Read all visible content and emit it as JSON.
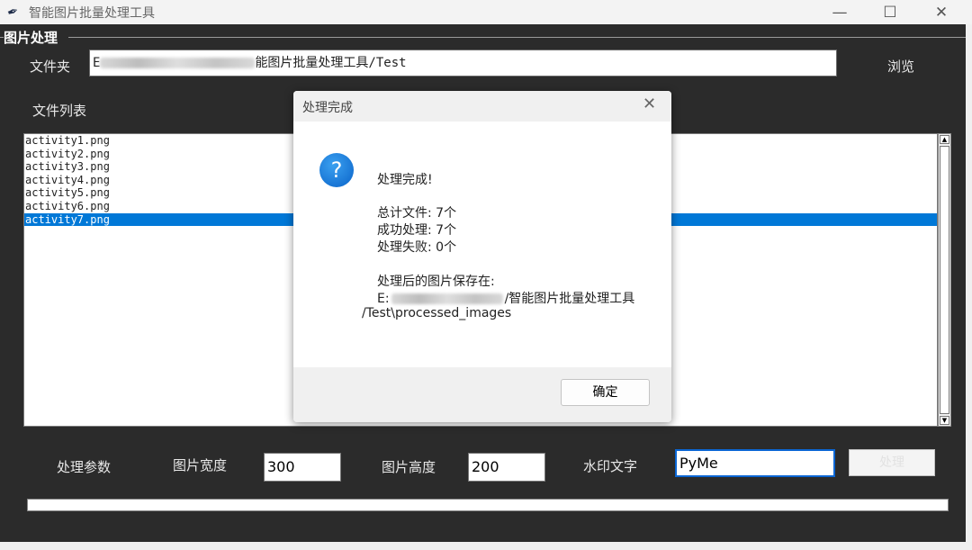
{
  "window": {
    "title": "智能图片批量处理工具",
    "min_glyph": "—",
    "max_glyph": "☐",
    "close_glyph": "✕"
  },
  "frame": {
    "label": "图片处理"
  },
  "folder": {
    "label": "文件夹",
    "path_prefix": "E",
    "path_suffix": "能图片批量处理工具/Test",
    "browse_label": "浏览"
  },
  "file_list": {
    "label": "文件列表",
    "items": [
      "activity1.png",
      "activity2.png",
      "activity3.png",
      "activity4.png",
      "activity5.png",
      "activity6.png",
      "activity7.png"
    ],
    "selected_index": 6
  },
  "params": {
    "section_label": "处理参数",
    "width_label": "图片宽度",
    "width_value": "300",
    "height_label": "图片高度",
    "height_value": "200",
    "watermark_label": "水印文字",
    "watermark_value": "PyMe",
    "apply_label": "处理"
  },
  "progress": {
    "value": 0
  },
  "dialog": {
    "title": "处理完成",
    "close_glyph": "✕",
    "icon_glyph": "?",
    "heading": "处理完成!",
    "total": "总计文件: 7个",
    "success": "成功处理: 7个",
    "failed": "处理失败: 0个",
    "saved_label": "处理后的图片保存在:",
    "path_prefix": "E:",
    "path_line1_suffix": "/智能图片批量处理工具",
    "path_line2": "/Test\\processed_images",
    "ok_label": "确定"
  },
  "colors": {
    "client_bg": "#2b2b2b",
    "selection": "#0078d7",
    "focus_border": "#0b66d4"
  }
}
